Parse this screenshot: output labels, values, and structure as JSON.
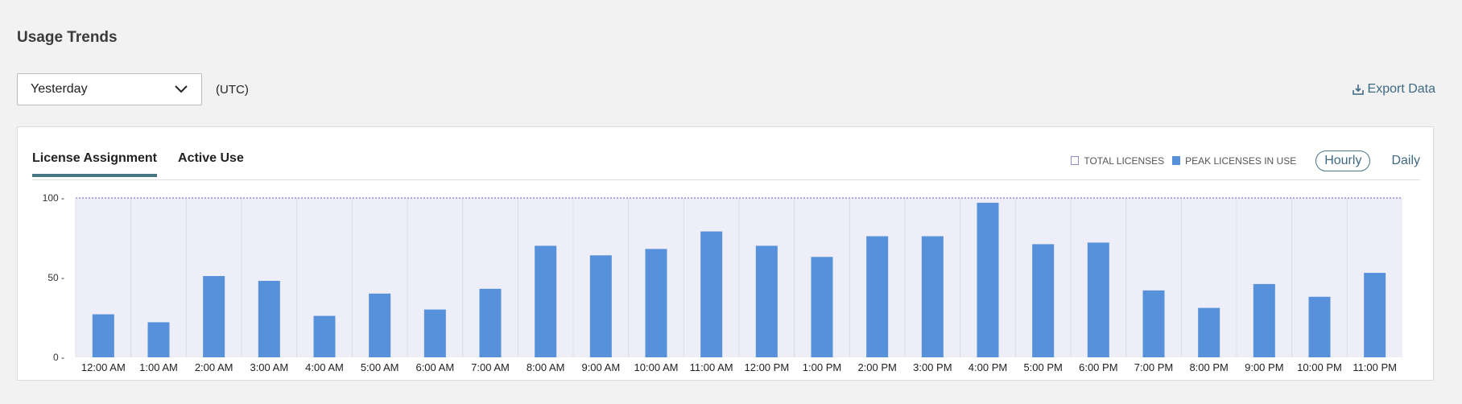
{
  "page": {
    "title": "Usage Trends",
    "range_value": "Yesterday",
    "timezone": "(UTC)",
    "export_label": "Export Data"
  },
  "tabs": [
    {
      "label": "License Assignment",
      "active": true
    },
    {
      "label": "Active Use",
      "active": false
    }
  ],
  "legend": {
    "total": "TOTAL LICENSES",
    "peak": "PEAK LICENSES IN USE"
  },
  "granularity": {
    "hourly": "Hourly",
    "daily": "Daily",
    "selected": "Hourly"
  },
  "colors": {
    "bar": "#5891db",
    "plot_bg": "#eeeef8",
    "total_line": "#a9a6e0",
    "accent": "#4a7585"
  },
  "chart_data": {
    "type": "bar",
    "categories": [
      "12:00 AM",
      "1:00 AM",
      "2:00 AM",
      "3:00 AM",
      "4:00 AM",
      "5:00 AM",
      "6:00 AM",
      "7:00 AM",
      "8:00 AM",
      "9:00 AM",
      "10:00 AM",
      "11:00 AM",
      "12:00 PM",
      "1:00 PM",
      "2:00 PM",
      "3:00 PM",
      "4:00 PM",
      "5:00 PM",
      "6:00 PM",
      "7:00 PM",
      "8:00 PM",
      "9:00 PM",
      "10:00 PM",
      "11:00 PM"
    ],
    "series": [
      {
        "name": "PEAK LICENSES IN USE",
        "values": [
          27,
          22,
          51,
          48,
          26,
          40,
          30,
          43,
          70,
          64,
          68,
          79,
          70,
          63,
          76,
          76,
          97,
          71,
          72,
          42,
          31,
          46,
          38,
          53
        ]
      },
      {
        "name": "TOTAL LICENSES",
        "values": [
          100,
          100,
          100,
          100,
          100,
          100,
          100,
          100,
          100,
          100,
          100,
          100,
          100,
          100,
          100,
          100,
          100,
          100,
          100,
          100,
          100,
          100,
          100,
          100
        ]
      }
    ],
    "yticks": [
      0,
      50,
      100
    ],
    "ylim": [
      0,
      100
    ],
    "xlabel": "",
    "ylabel": ""
  }
}
